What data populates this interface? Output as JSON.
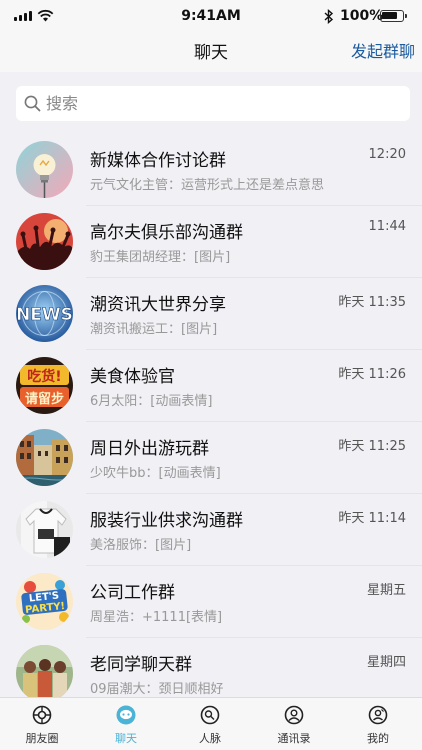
{
  "status_bar": {
    "time": "9:41AM",
    "battery": "100%"
  },
  "nav": {
    "title": "聊天",
    "action": "发起群聊"
  },
  "search": {
    "placeholder": "搜索",
    "value": ""
  },
  "chats": [
    {
      "name": "新媒体合作讨论群",
      "preview": "元气文化主管：运营形式上还是差点意思",
      "time": "12:20",
      "avatar": "lightbulb-avatar"
    },
    {
      "name": "高尔夫俱乐部沟通群",
      "preview": "豹王集团胡经理：[图片]",
      "time": "11:44",
      "avatar": "crowd-avatar"
    },
    {
      "name": "潮资讯大世界分享",
      "preview": "潮资讯搬运工：[图片]",
      "time": "昨天 11:35",
      "avatar": "news-avatar"
    },
    {
      "name": "美食体验官",
      "preview": "6月太阳：[动画表情]",
      "time": "昨天 11:26",
      "avatar": "foodie-avatar"
    },
    {
      "name": "周日外出游玩群",
      "preview": "少吹牛bb：[动画表情]",
      "time": "昨天 11:25",
      "avatar": "canal-avatar"
    },
    {
      "name": "服装行业供求沟通群",
      "preview": "美洛服饰：[图片]",
      "time": "昨天 11:14",
      "avatar": "clothing-avatar"
    },
    {
      "name": "公司工作群",
      "preview": "周星浩：+1111[表情]",
      "time": "星期五",
      "avatar": "party-avatar"
    },
    {
      "name": "老同学聊天群",
      "preview": "09届潮大：颈日顺相好",
      "time": "星期四",
      "avatar": "classmates-avatar"
    }
  ],
  "avatar_text": {
    "news": "NEWS",
    "foodie_line1": "吃货!",
    "foodie_line2": "请留步",
    "party_line1": "LET'S",
    "party_line2": "PARTY!"
  },
  "tabs": [
    {
      "label": "朋友圈",
      "icon": "moments-icon",
      "active": false
    },
    {
      "label": "聊天",
      "icon": "chat-bubble-icon",
      "active": true
    },
    {
      "label": "人脉",
      "icon": "contacts-network-icon",
      "active": false
    },
    {
      "label": "通讯录",
      "icon": "address-book-icon",
      "active": false
    },
    {
      "label": "我的",
      "icon": "profile-icon",
      "active": false
    }
  ],
  "colors": {
    "accent": "#1c5b9e",
    "active_tab": "#4bb3d6",
    "list_bg": "#f0f0f5"
  }
}
